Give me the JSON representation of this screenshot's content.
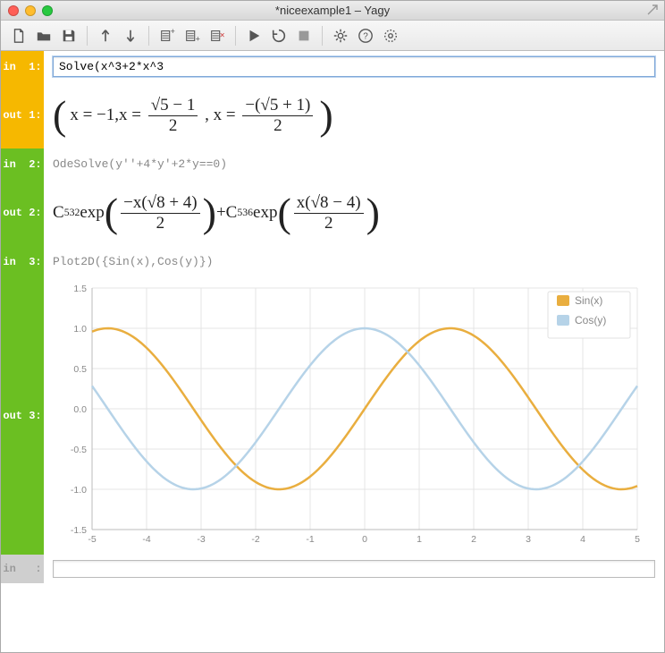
{
  "window": {
    "title": "*niceexample1 – Yagy"
  },
  "traffic_lights": {
    "close": "#ff5f57",
    "minimize": "#ffbd2e",
    "zoom": "#28c940"
  },
  "toolbar": {
    "items": [
      "new-file",
      "open-file",
      "save-file",
      "|",
      "move-up",
      "move-down",
      "|",
      "insert-above",
      "insert-below",
      "remove-cell",
      "|",
      "run",
      "reload",
      "stop",
      "|",
      "settings",
      "help",
      "target"
    ]
  },
  "cells": [
    {
      "type": "in",
      "label": "in  1:",
      "color": "orange",
      "input": "Solve(x^3+2*x^3"
    },
    {
      "type": "out",
      "label": "out 1:",
      "color": "orange"
    },
    {
      "type": "in",
      "label": "in  2:",
      "color": "green",
      "code": "OdeSolve(y''+4*y'+2*y==0)"
    },
    {
      "type": "out",
      "label": "out 2:",
      "color": "green"
    },
    {
      "type": "in",
      "label": "in  3:",
      "color": "green",
      "code": "Plot2D({Sin(x),Cos(y)})"
    },
    {
      "type": "out",
      "label": "out 3:",
      "color": "green"
    },
    {
      "type": "in",
      "label": "in   :",
      "color": "gray"
    }
  ],
  "math": {
    "out1_x1": "x = −1,",
    "out1_x2": "x = ",
    "out1_num2": "√5 − 1",
    "out1_den2": "2",
    "out1_sep": " , x = ",
    "out1_num3": "−(√5 + 1)",
    "out1_den3": "2",
    "out2_c1": "C",
    "out2_sub1": "532",
    "out2_exp": " exp",
    "out2_num1": "−x(√8 + 4)",
    "out2_den": "2",
    "out2_plus": " + ",
    "out2_c2": "C",
    "out2_sub2": "536",
    "out2_num2": "x(√8 − 4)"
  },
  "chart_data": {
    "type": "line",
    "xlabel": "",
    "ylabel": "",
    "xlim": [
      -5,
      5
    ],
    "ylim": [
      -1.5,
      1.5
    ],
    "xticks": [
      -5,
      -4,
      -3,
      -2,
      -1,
      0,
      1,
      2,
      3,
      4,
      5
    ],
    "yticks": [
      -1.5,
      -1.0,
      -0.5,
      0.0,
      0.5,
      1.0,
      1.5
    ],
    "series": [
      {
        "name": "Sin(x)",
        "color": "#e9ae3f",
        "fn": "sin"
      },
      {
        "name": "Cos(y)",
        "color": "#b6d3e8",
        "fn": "cos"
      }
    ],
    "legend_position": "top-right"
  }
}
